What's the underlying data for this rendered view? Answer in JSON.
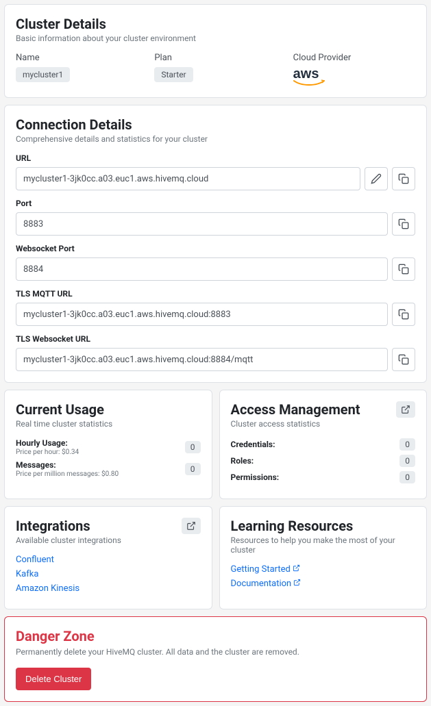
{
  "cluster_details": {
    "title": "Cluster Details",
    "subtitle": "Basic information about your cluster environment",
    "name_label": "Name",
    "name_value": "mycluster1",
    "plan_label": "Plan",
    "plan_value": "Starter",
    "provider_label": "Cloud Provider",
    "provider_value": "aws"
  },
  "connection": {
    "title": "Connection Details",
    "subtitle": "Comprehensive details and statistics for your cluster",
    "url_label": "URL",
    "url_value": "mycluster1-3jk0cc.a03.euc1.aws.hivemq.cloud",
    "port_label": "Port",
    "port_value": "8883",
    "ws_port_label": "Websocket Port",
    "ws_port_value": "8884",
    "tls_mqtt_label": "TLS MQTT URL",
    "tls_mqtt_value": "mycluster1-3jk0cc.a03.euc1.aws.hivemq.cloud:8883",
    "tls_ws_label": "TLS Websocket URL",
    "tls_ws_value": "mycluster1-3jk0cc.a03.euc1.aws.hivemq.cloud:8884/mqtt"
  },
  "usage": {
    "title": "Current Usage",
    "subtitle": "Real time cluster statistics",
    "hourly_label": "Hourly Usage:",
    "hourly_sub": "Price per hour: $0.34",
    "hourly_value": "0",
    "messages_label": "Messages:",
    "messages_sub": "Price per million messages: $0.80",
    "messages_value": "0"
  },
  "access": {
    "title": "Access Management",
    "subtitle": "Cluster access statistics",
    "credentials_label": "Credentials:",
    "credentials_value": "0",
    "roles_label": "Roles:",
    "roles_value": "0",
    "permissions_label": "Permissions:",
    "permissions_value": "0"
  },
  "integrations": {
    "title": "Integrations",
    "subtitle": "Available cluster integrations",
    "links": {
      "confluent": "Confluent",
      "kafka": "Kafka",
      "kinesis": "Amazon Kinesis"
    }
  },
  "learning": {
    "title": "Learning Resources",
    "subtitle": "Resources to help you make the most of your cluster",
    "links": {
      "getting_started": "Getting Started",
      "documentation": "Documentation"
    }
  },
  "danger": {
    "title": "Danger Zone",
    "subtitle": "Permanently delete your HiveMQ cluster. All data and the cluster are removed.",
    "delete_label": "Delete Cluster"
  }
}
